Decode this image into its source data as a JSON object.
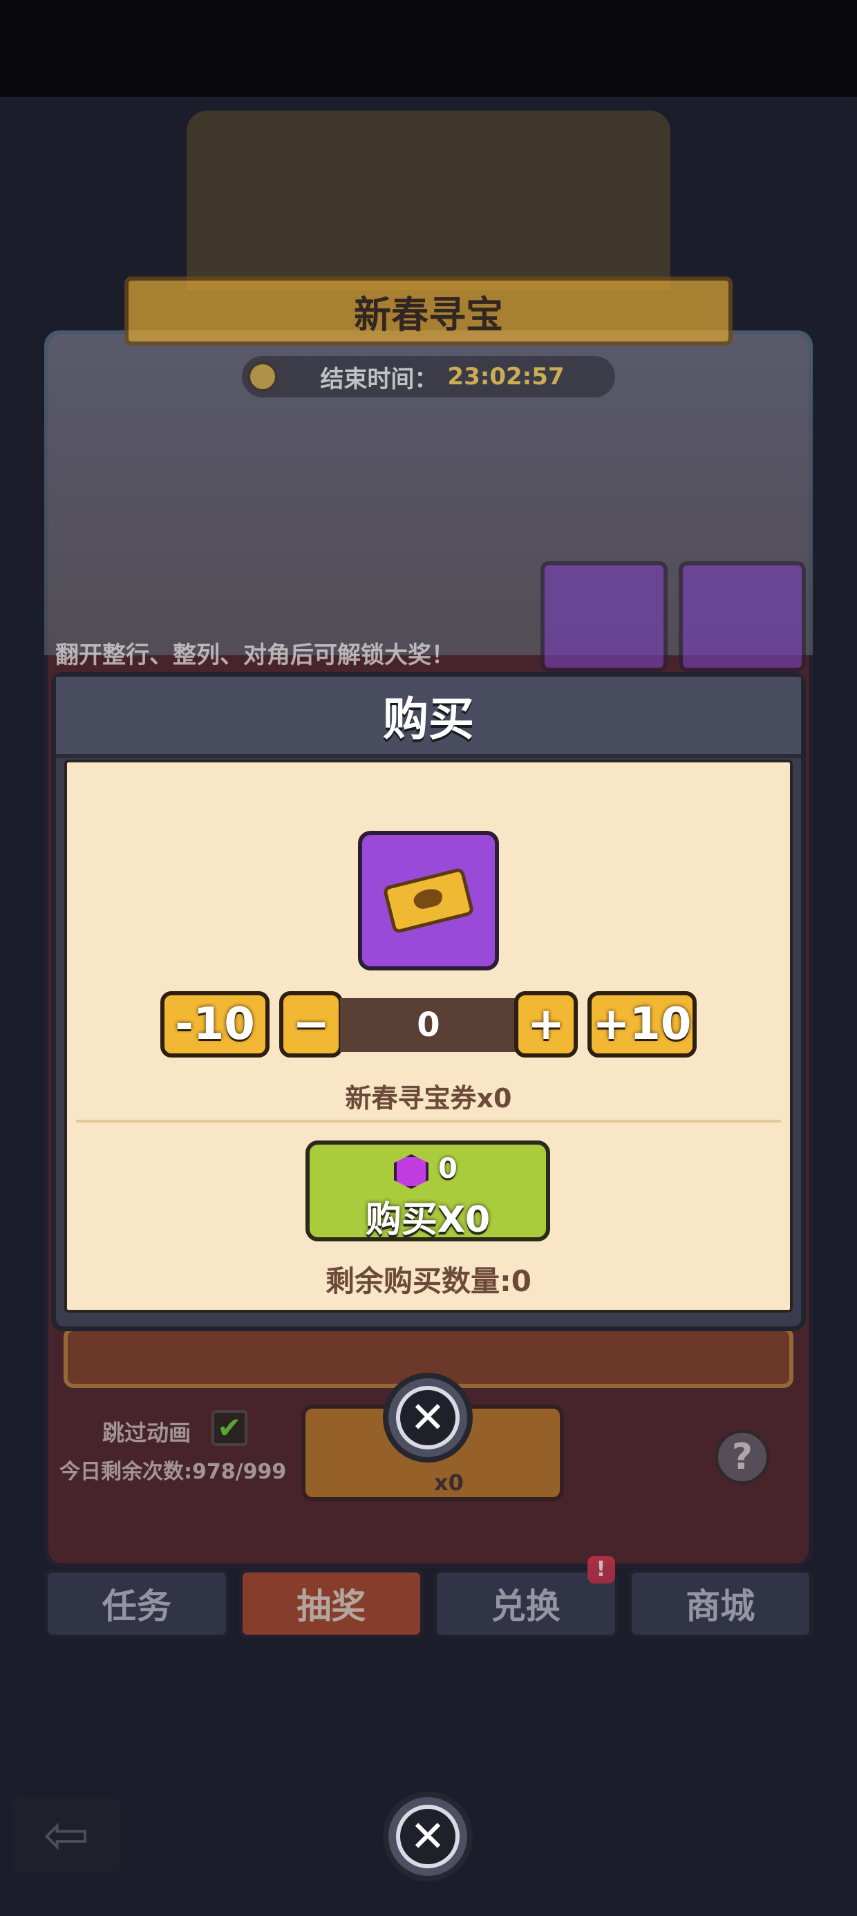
{
  "event": {
    "title": "新春寻宝",
    "timer_label": "结束时间：",
    "timer_value": "23:02:57",
    "hint": "翻开整行、整列、对角后可解锁大奖！",
    "skip_animation_label": "跳过动画",
    "daily_remaining": "今日剩余次数:978/999",
    "draw_cost": "x0"
  },
  "tabs": [
    {
      "label": "任务"
    },
    {
      "label": "抽奖"
    },
    {
      "label": "兑换"
    },
    {
      "label": "商城"
    }
  ],
  "exchange_badge": "!",
  "modal": {
    "title": "购买",
    "minus10": "-10",
    "minus": "−",
    "quantity": "0",
    "plus": "+",
    "plus10": "+10",
    "owned": "新春寻宝券x0",
    "price": "0",
    "buy_label": "购买X0",
    "remaining": "剩余购买数量:0"
  },
  "colors": {
    "accent_gold": "#f3b833",
    "buy_green": "#a9cb3c",
    "panel_cream": "#f8e6c6",
    "item_purple": "#9a4ad8"
  }
}
